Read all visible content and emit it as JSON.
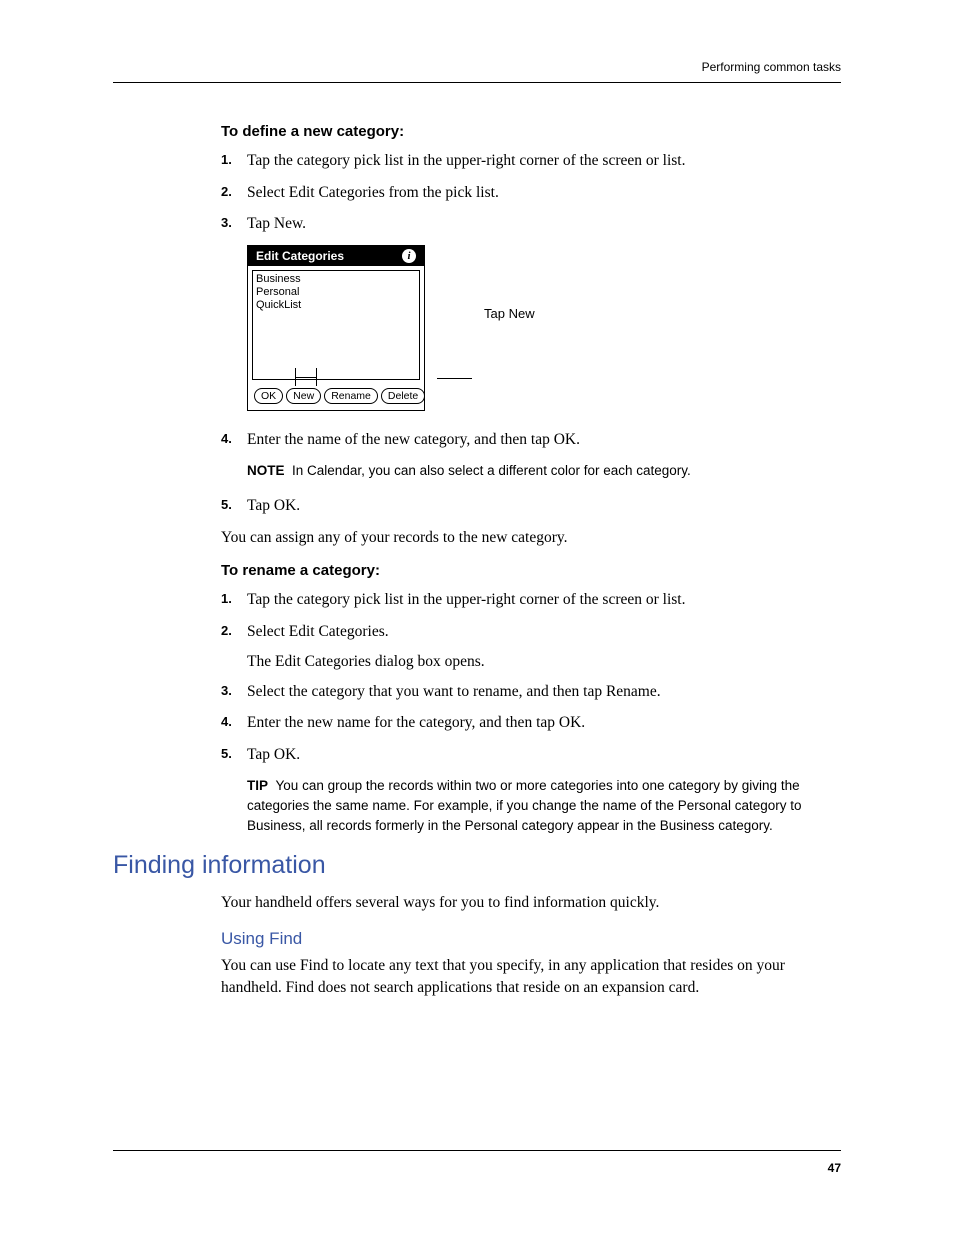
{
  "header": {
    "running_title": "Performing common tasks"
  },
  "section1": {
    "heading": "To define a new category:",
    "step1": "Tap the category pick list in the upper-right corner of the screen or list.",
    "step2": "Select Edit Categories from the pick list.",
    "step3": "Tap New.",
    "step4": "Enter the name of the new category, and then tap OK.",
    "note_label": "NOTE",
    "note_text": "In Calendar, you can also select a different color for each category.",
    "step5": "Tap OK.",
    "assign_text": "You can assign any of your records to the new category."
  },
  "figure": {
    "title": "Edit Categories",
    "items": {
      "i1": "Business",
      "i2": "Personal",
      "i3": "QuickList"
    },
    "buttons": {
      "ok": "OK",
      "new": "New",
      "rename": "Rename",
      "delete": "Delete"
    },
    "callout": "Tap New"
  },
  "section2": {
    "heading": "To rename a category:",
    "step1": "Tap the category pick list in the upper-right corner of the screen or list.",
    "step2": "Select Edit Categories.",
    "body1": "The Edit Categories dialog box opens.",
    "step3": "Select the category that you want to rename, and then tap Rename.",
    "step4": "Enter the new name for the category, and then tap OK.",
    "step5": "Tap OK.",
    "tip_label": "TIP",
    "tip_text": "You can group the records within two or more categories into one category by giving the categories the same name. For example, if you change the name of the Personal category to Business, all records formerly in the Personal category appear in the Business category."
  },
  "section3": {
    "h1": "Finding information",
    "intro": "Your handheld offers several ways for you to find information quickly.",
    "h2": "Using Find",
    "body": "You can use Find to locate any text that you specify, in any application that resides on your handheld. Find does not search applications that reside on an expansion card."
  },
  "footer": {
    "page_number": "47"
  }
}
